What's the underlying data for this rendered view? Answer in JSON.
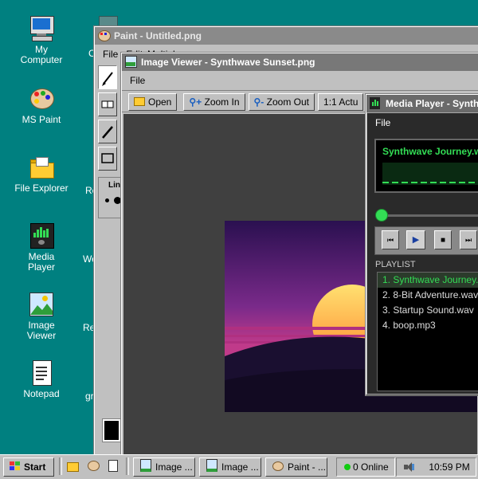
{
  "desktop": {
    "icons": [
      {
        "label_line1": "My",
        "label_line2": "Computer",
        "icon": "computer-icon"
      },
      {
        "label_line1": "MS Paint",
        "label_line2": "",
        "icon": "palette-icon"
      },
      {
        "label_line1": "File Explorer",
        "label_line2": "",
        "icon": "folder-icon"
      },
      {
        "label_line1": "Media",
        "label_line2": "Player",
        "icon": "media-player-icon"
      },
      {
        "label_line1": "Image",
        "label_line2": "Viewer",
        "icon": "image-icon"
      },
      {
        "label_line1": "Notepad",
        "label_line2": "",
        "icon": "notepad-icon"
      }
    ],
    "partial_labels": [
      "C",
      "Re",
      "We",
      "Re",
      "gr"
    ]
  },
  "paint": {
    "title": "Paint - Untitled.png",
    "menu": [
      "File",
      "Edit",
      "Multipl"
    ],
    "line_label": "Line"
  },
  "viewer": {
    "title": "Image Viewer - Synthwave Sunset.png",
    "menu_file": "File",
    "toolbar": {
      "open": "Open",
      "zoom_in": "Zoom In",
      "zoom_out": "Zoom Out",
      "actual": "1:1  Actu"
    }
  },
  "media": {
    "title": "Media Player - Synthwa",
    "menu_file": "File",
    "now_playing": "Synthwave Journey.wav",
    "playlist_header": "PLAYLIST",
    "playlist": [
      "1. Synthwave Journey.wav",
      "2. 8-Bit Adventure.wav",
      "3. Startup Sound.wav",
      "4. boop.mp3"
    ],
    "accent": "#33dd55"
  },
  "taskbar": {
    "start": "Start",
    "tasks": [
      "Image ...",
      "Image ...",
      "Paint - ..."
    ],
    "online": "0 Online",
    "clock": "10:59 PM"
  }
}
